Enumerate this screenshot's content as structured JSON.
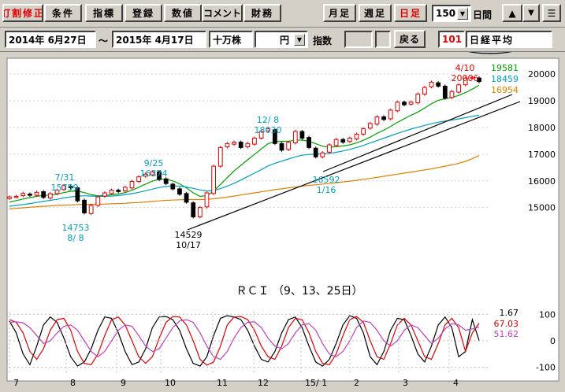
{
  "toolbar": {
    "buttons": [
      {
        "label": "訂割修正",
        "red": true
      },
      {
        "label": "条件"
      },
      {
        "label": "指標"
      },
      {
        "label": "登録"
      },
      {
        "label": "数値"
      },
      {
        "label": "コメント"
      },
      {
        "label": "財務"
      }
    ],
    "period_buttons": [
      {
        "label": "月足"
      },
      {
        "label": "週足"
      },
      {
        "label": "日足",
        "red": true
      }
    ],
    "bars_value": "150",
    "bars_unit": "日間",
    "up_icon": "up-arrow-icon",
    "down_icon": "down-triangle-icon",
    "menu_icon": "menu-icon"
  },
  "rangebar": {
    "date_from": "2014年 6月27日",
    "tilde": "～",
    "date_to": "2015年 4月17日",
    "unit": "十万株",
    "currency": "円",
    "index_label": "指数",
    "back_button": "戻る",
    "code": "101",
    "name": "日経平均"
  },
  "colors": {
    "up": "#e00000",
    "down": "#000000",
    "ma9": "#00a000",
    "ma13": "#00a0c0",
    "ma25": "#e08000",
    "rci9": "#000000",
    "rci13": "#e00000",
    "rci25": "#c040c0"
  },
  "chart_data": [
    {
      "type": "line",
      "subtype": "candlestick",
      "y_ticks": [
        "20000",
        "19000",
        "18000",
        "17000",
        "16000",
        "15000"
      ],
      "ylim": [
        14400,
        20300
      ],
      "x_months": [
        "7",
        "8",
        "9",
        "10",
        "11",
        "12",
        "15/ 1",
        "2",
        "3",
        "4"
      ],
      "close": [
        15400,
        15420,
        15530,
        15460,
        15570,
        15380,
        15520,
        15650,
        15820,
        15740,
        15250,
        14800,
        15080,
        15400,
        15550,
        15650,
        15600,
        15760,
        15980,
        16150,
        16250,
        16340,
        16050,
        15900,
        15700,
        15500,
        15200,
        14650,
        15000,
        15550,
        16550,
        17250,
        17400,
        17450,
        17250,
        17400,
        17600,
        17850,
        17950,
        17400,
        17150,
        17450,
        17850,
        17600,
        17250,
        16900,
        17050,
        17350,
        17550,
        17450,
        17600,
        17750,
        17950,
        18150,
        18400,
        18300,
        18650,
        18950,
        18850,
        18950,
        19250,
        19500,
        19700,
        19550,
        19100,
        19350,
        19600,
        19850,
        19880,
        19720
      ],
      "series_lines": [
        {
          "name": "19581",
          "values": [
            15200,
            15260,
            15320,
            15370,
            15420,
            15450,
            15470,
            15500,
            15560,
            15610,
            15620,
            15560,
            15480,
            15440,
            15450,
            15480,
            15510,
            15560,
            15650,
            15760,
            15880,
            15990,
            16060,
            16060,
            16000,
            15890,
            15740,
            15550,
            15420,
            15440,
            15620,
            15870,
            16120,
            16370,
            16580,
            16790,
            16990,
            17200,
            17390,
            17470,
            17480,
            17490,
            17520,
            17530,
            17480,
            17390,
            17300,
            17260,
            17280,
            17310,
            17350,
            17420,
            17520,
            17640,
            17780,
            17900,
            18040,
            18190,
            18330,
            18460,
            18580,
            18730,
            18890,
            19020,
            19080,
            19130,
            19200,
            19310,
            19440,
            19581
          ]
        },
        {
          "name": "18459",
          "values": [
            15050,
            15080,
            15110,
            15150,
            15190,
            15230,
            15270,
            15310,
            15360,
            15400,
            15430,
            15440,
            15430,
            15420,
            15420,
            15430,
            15450,
            15480,
            15520,
            15570,
            15630,
            15690,
            15750,
            15790,
            15810,
            15800,
            15770,
            15720,
            15660,
            15620,
            15640,
            15710,
            15800,
            15910,
            16030,
            16160,
            16290,
            16420,
            16560,
            16660,
            16740,
            16820,
            16900,
            16960,
            16990,
            17000,
            17010,
            17030,
            17070,
            17120,
            17180,
            17250,
            17330,
            17420,
            17510,
            17600,
            17690,
            17780,
            17860,
            17940,
            18010,
            18080,
            18140,
            18200,
            18240,
            18280,
            18320,
            18370,
            18420,
            18459
          ]
        },
        {
          "name": "16954",
          "values": [
            14950,
            14970,
            14990,
            15010,
            15030,
            15050,
            15060,
            15080,
            15090,
            15100,
            15110,
            15120,
            15120,
            15120,
            15130,
            15140,
            15150,
            15160,
            15180,
            15190,
            15210,
            15230,
            15250,
            15270,
            15280,
            15290,
            15300,
            15300,
            15300,
            15310,
            15330,
            15360,
            15390,
            15430,
            15470,
            15510,
            15550,
            15590,
            15630,
            15670,
            15700,
            15740,
            15770,
            15800,
            15830,
            15850,
            15880,
            15900,
            15930,
            15960,
            15990,
            16020,
            16060,
            16090,
            16130,
            16170,
            16210,
            16250,
            16290,
            16330,
            16370,
            16410,
            16450,
            16500,
            16550,
            16600,
            16660,
            16730,
            16830,
            16954
          ]
        }
      ],
      "annotations": [
        {
          "text": "7/31",
          "color": "#00a0c0"
        },
        {
          "text": "15759",
          "color": "#00a0c0"
        },
        {
          "text": "14753",
          "color": "#00a0c0"
        },
        {
          "text": "8/ 8",
          "color": "#00a0c0"
        },
        {
          "text": "9/25",
          "color": "#00a0c0"
        },
        {
          "text": "16374",
          "color": "#00a0c0"
        },
        {
          "text": "14529",
          "color": "#000000"
        },
        {
          "text": "10/17",
          "color": "#000000"
        },
        {
          "text": "12/ 8",
          "color": "#00a0c0"
        },
        {
          "text": "18030",
          "color": "#00a0c0"
        },
        {
          "text": "16592",
          "color": "#00a0c0"
        },
        {
          "text": "1/16",
          "color": "#00a0c0"
        },
        {
          "text": "4/10",
          "color": "#e00000"
        },
        {
          "text": "20006",
          "color": "#e00000"
        }
      ]
    },
    {
      "type": "line",
      "title": "ＲＣＩ （9、13、25日）",
      "y_ticks": [
        "100",
        "0",
        "-100"
      ],
      "ylim": [
        -110,
        110
      ],
      "series": [
        {
          "name": "1.67",
          "values": [
            75,
            30,
            -50,
            -90,
            -20,
            60,
            90,
            70,
            10,
            -60,
            -95,
            -80,
            -30,
            40,
            90,
            85,
            30,
            -40,
            -90,
            -80,
            -30,
            50,
            90,
            92,
            80,
            40,
            -30,
            -85,
            -95,
            -60,
            20,
            85,
            95,
            90,
            80,
            40,
            -20,
            -70,
            -80,
            -40,
            30,
            80,
            90,
            50,
            -20,
            -80,
            -95,
            -70,
            -10,
            60,
            95,
            85,
            30,
            -60,
            -90,
            -40,
            40,
            85,
            80,
            20,
            -50,
            -80,
            -20,
            60,
            90,
            50,
            -60,
            -40,
            80,
            1.67
          ]
        },
        {
          "name": "67.03",
          "values": [
            80,
            70,
            30,
            -40,
            -70,
            -30,
            40,
            80,
            85,
            40,
            -40,
            -85,
            -90,
            -50,
            20,
            80,
            90,
            60,
            0,
            -60,
            -85,
            -60,
            10,
            70,
            92,
            90,
            60,
            0,
            -70,
            -92,
            -80,
            -20,
            60,
            90,
            92,
            80,
            40,
            -20,
            -60,
            -70,
            -20,
            50,
            85,
            80,
            30,
            -40,
            -85,
            -90,
            -50,
            20,
            80,
            92,
            70,
            0,
            -60,
            -70,
            -10,
            60,
            85,
            60,
            0,
            -60,
            -70,
            -10,
            60,
            85,
            50,
            -40,
            30,
            67.03
          ]
        },
        {
          "name": "51.62",
          "values": [
            70,
            72,
            68,
            50,
            20,
            -10,
            0,
            30,
            55,
            60,
            40,
            0,
            -40,
            -60,
            -40,
            0,
            40,
            60,
            55,
            20,
            -20,
            -40,
            -30,
            10,
            50,
            75,
            80,
            70,
            30,
            -20,
            -60,
            -70,
            -40,
            10,
            50,
            70,
            72,
            50,
            10,
            -20,
            -30,
            -10,
            30,
            60,
            65,
            40,
            -10,
            -50,
            -60,
            -40,
            0,
            50,
            75,
            70,
            40,
            0,
            -20,
            0,
            40,
            60,
            50,
            20,
            -10,
            10,
            45,
            65,
            60,
            40,
            45,
            51.62
          ]
        }
      ]
    }
  ]
}
